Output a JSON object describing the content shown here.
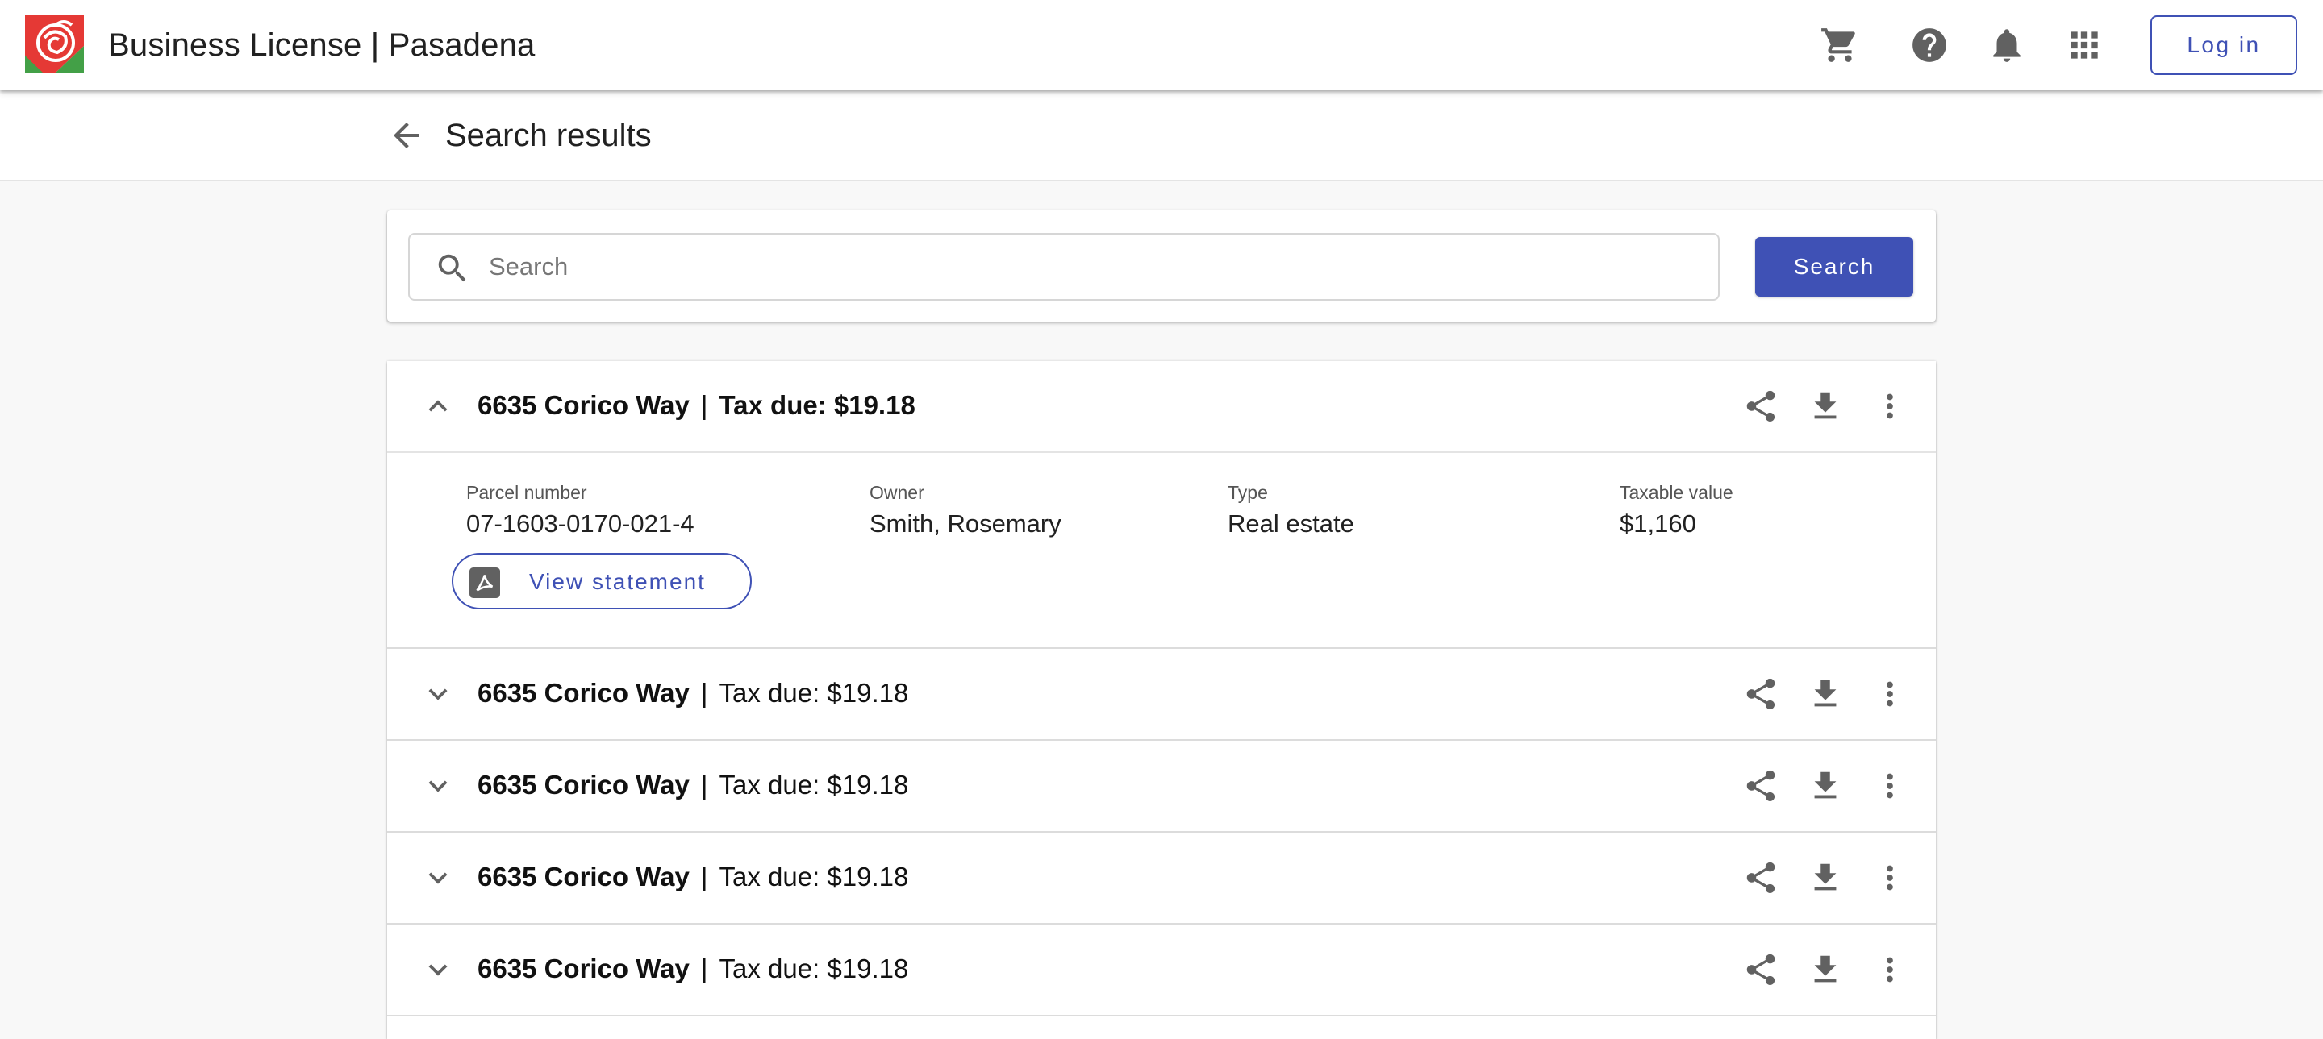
{
  "app": {
    "title": "Business License | Pasadena",
    "login_label": "Log in",
    "icons": [
      "cart-icon",
      "help-icon",
      "notifications-icon",
      "apps-grid-icon"
    ]
  },
  "subheader": {
    "title": "Search results"
  },
  "search": {
    "placeholder": "Search",
    "value": "",
    "button_label": "Search"
  },
  "results": [
    {
      "address": "6635 Corico Way",
      "separator": "|",
      "tax": "Tax due: $19.18",
      "expanded": true,
      "fields": [
        {
          "label": "Parcel number",
          "value": "07-1603-0170-021-4"
        },
        {
          "label": "Owner",
          "value": "Smith, Rosemary"
        },
        {
          "label": "Type",
          "value": "Real estate"
        },
        {
          "label": "Taxable value",
          "value": "$1,160"
        }
      ],
      "statement_label": "View statement"
    },
    {
      "address": "6635 Corico Way",
      "separator": "|",
      "tax": "Tax due: $19.18",
      "expanded": false
    },
    {
      "address": "6635 Corico Way",
      "separator": "|",
      "tax": "Tax due: $19.18",
      "expanded": false
    },
    {
      "address": "6635 Corico Way",
      "separator": "|",
      "tax": "Tax due: $19.18",
      "expanded": false
    },
    {
      "address": "6635 Corico Way",
      "separator": "|",
      "tax": "Tax due: $19.18",
      "expanded": false
    }
  ],
  "colors": {
    "primary": "#3f51b5",
    "icon_gray": "#616161",
    "logo_red": "#e53935",
    "logo_green": "#43a047"
  }
}
